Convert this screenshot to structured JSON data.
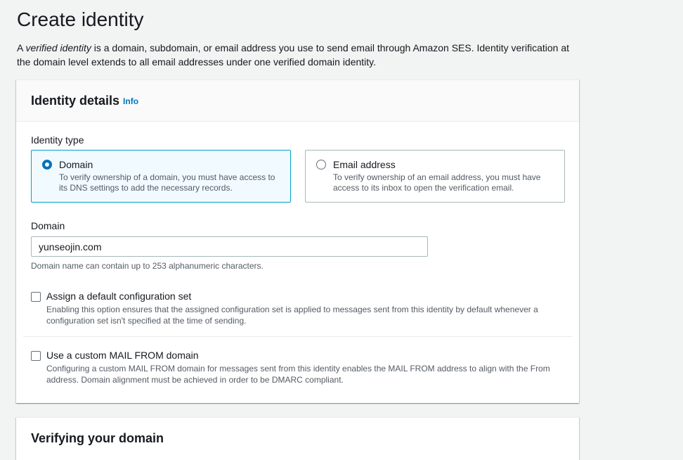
{
  "page": {
    "title": "Create identity",
    "desc_italic": "verified identity",
    "desc_prefix": "A ",
    "desc_suffix": " is a domain, subdomain, or email address you use to send email through Amazon SES. Identity verification at the domain level extends to all email addresses under one verified domain identity."
  },
  "identity_details": {
    "header": "Identity details",
    "info_label": "Info",
    "identity_type_label": "Identity type",
    "options": [
      {
        "title": "Domain",
        "desc": "To verify ownership of a domain, you must have access to its DNS settings to add the necessary records.",
        "selected": true
      },
      {
        "title": "Email address",
        "desc": "To verify ownership of an email address, you must have access to its inbox to open the verification email.",
        "selected": false
      }
    ],
    "domain_label": "Domain",
    "domain_value": "yunseojin.com",
    "domain_hint": "Domain name can contain up to 253 alphanumeric characters.",
    "config_set": {
      "title": "Assign a default configuration set",
      "desc": "Enabling this option ensures that the assigned configuration set is applied to messages sent from this identity by default whenever a configuration set isn't specified at the time of sending."
    },
    "mail_from": {
      "title": "Use a custom MAIL FROM domain",
      "desc": "Configuring a custom MAIL FROM domain for messages sent from this identity enables the MAIL FROM address to align with the From address. Domain alignment must be achieved in order to be DMARC compliant."
    }
  },
  "verifying": {
    "header": "Verifying your domain"
  },
  "colors": {
    "accent": "#0073bb",
    "selected_border": "#00a1c9",
    "selected_bg": "#f1faff",
    "background": "#f2f3f3"
  }
}
